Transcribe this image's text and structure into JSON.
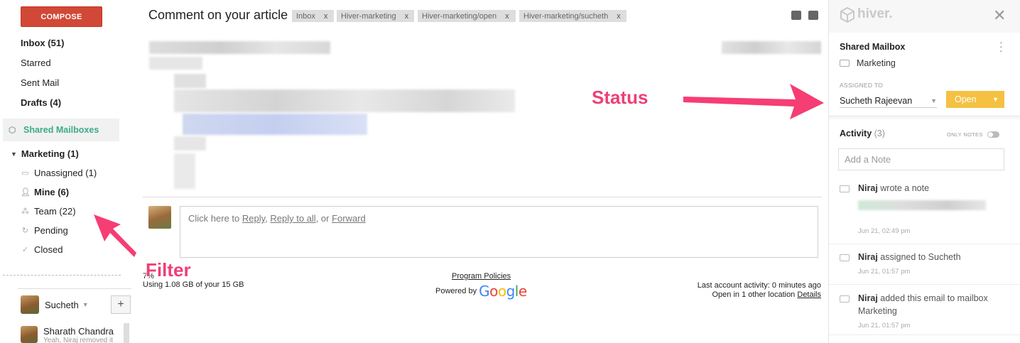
{
  "leftnav": {
    "compose": "COMPOSE",
    "items": [
      {
        "label": "Inbox (51)",
        "bold": true
      },
      {
        "label": "Starred",
        "bold": false
      },
      {
        "label": "Sent Mail",
        "bold": false
      },
      {
        "label": "Drafts (4)",
        "bold": true
      }
    ],
    "shared_mailboxes": "Shared Mailboxes",
    "marketing": "Marketing (1)",
    "filters": [
      {
        "label": "Unassigned (1)",
        "icon": "inbox-icon"
      },
      {
        "label": "Mine (6)",
        "icon": "person-icon"
      },
      {
        "label": "Team (22)",
        "icon": "team-icon"
      },
      {
        "label": "Pending",
        "icon": "pending-icon"
      },
      {
        "label": "Closed",
        "icon": "check-circle-icon"
      }
    ],
    "user_name": "Sucheth",
    "plus": "+",
    "contact_name": "Sharath Chandra",
    "contact_sub": "Yeah, Niraj removed it"
  },
  "main": {
    "subject": "Comment on your article",
    "labels": [
      "Inbox",
      "Hiver-marketing",
      "Hiver-marketing/open",
      "Hiver-marketing/sucheth"
    ],
    "label_close": "x",
    "reply_prefix": "Click here to ",
    "reply": "Reply",
    "reply_to_all": "Reply to all",
    "or": ", or ",
    "forward": "Forward",
    "comma": ", ",
    "storage_pct": "7%",
    "storage": "Using 1.08 GB of your 15 GB",
    "program_policies": "Program Policies",
    "powered_by": "Powered by",
    "google": "Google",
    "last_activity": "Last account activity: 0 minutes ago",
    "open_in": "Open in 1 other location",
    "details": "Details"
  },
  "annotations": {
    "status": "Status",
    "filter": "Filter",
    "color": "#ee3f76"
  },
  "hiver": {
    "logo": "hiver.",
    "close": "✕",
    "shared_mailbox_title": "Shared Mailbox",
    "mailbox": "Marketing",
    "assigned_to_label": "ASSIGNED TO",
    "assignee": "Sucheth Rajeevan",
    "status": "Open",
    "status_color": "#f5c142",
    "activity_title": "Activity",
    "activity_count": "(3)",
    "only_notes": "ONLY NOTES",
    "note_placeholder": "Add a Note",
    "entries": [
      {
        "actor": "Niraj",
        "text": " wrote a note",
        "time": "Jun 21, 02:49 pm"
      },
      {
        "actor": "Niraj",
        "text": " assigned to Sucheth",
        "time": "Jun 21, 01:57 pm"
      },
      {
        "actor": "Niraj",
        "text": " added this email to mailbox Marketing",
        "time": "Jun 21, 01:57 pm"
      }
    ]
  }
}
